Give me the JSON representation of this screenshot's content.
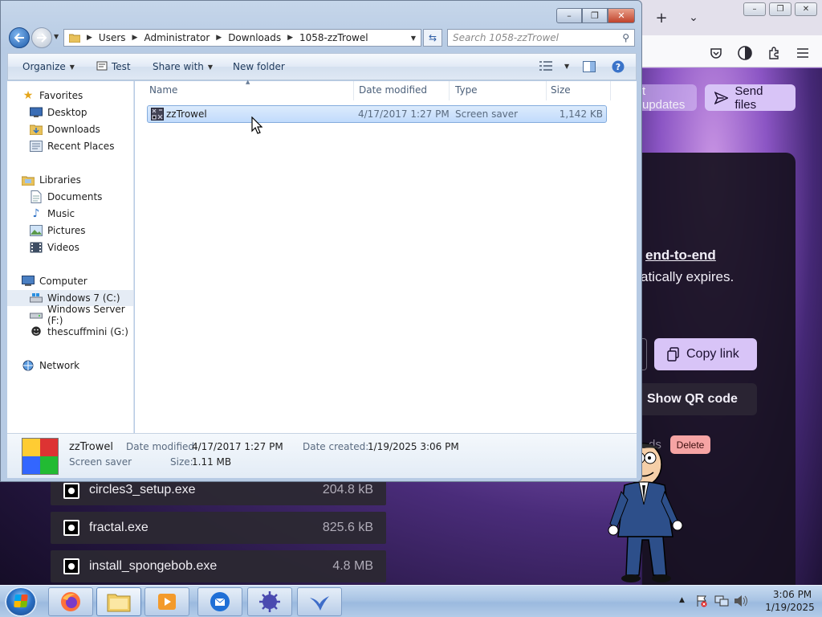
{
  "explorer": {
    "window_controls": {
      "minimize": "–",
      "maximize": "❐",
      "close": "✕"
    },
    "breadcrumb": [
      "Users",
      "Administrator",
      "Downloads",
      "1058-zzTrowel"
    ],
    "search_placeholder": "Search 1058-zzTrowel",
    "command_bar": {
      "organize": "Organize",
      "test": "Test",
      "share_with": "Share with",
      "new_folder": "New folder"
    },
    "nav": {
      "favorites": "Favorites",
      "favorites_items": [
        "Desktop",
        "Downloads",
        "Recent Places"
      ],
      "libraries": "Libraries",
      "libraries_items": [
        "Documents",
        "Music",
        "Pictures",
        "Videos"
      ],
      "computer": "Computer",
      "computer_items": [
        "Windows 7 (C:)",
        "Windows Server (F:)",
        "thescuffmini (G:)"
      ],
      "network": "Network"
    },
    "columns": {
      "name": "Name",
      "date": "Date modified",
      "type": "Type",
      "size": "Size"
    },
    "files": [
      {
        "name": "zzTrowel",
        "date": "4/17/2017 1:27 PM",
        "type": "Screen saver",
        "size": "1,142 KB"
      }
    ],
    "details": {
      "name": "zzTrowel",
      "kind": "Screen saver",
      "date_modified_label": "Date modified:",
      "date_modified": "4/17/2017 1:27 PM",
      "date_created_label": "Date created:",
      "date_created": "1/19/2025 3:06 PM",
      "size_label": "Size:",
      "size": "1.11 MB"
    }
  },
  "browser": {
    "new_tab": "+",
    "tab_list": "⌄",
    "window_controls": {
      "minimize": "–",
      "maximize": "❐",
      "close": "✕"
    },
    "page": {
      "updates_button": "t updates",
      "send_files_button": "Send files",
      "end_to_end": "end-to-end",
      "expires_text": "atically expires.",
      "copy_link": "Copy link",
      "show_qr": "Show QR code",
      "downloads_fragment": "ds",
      "delete": "Delete",
      "files": [
        {
          "name": "circles3_setup.exe",
          "size": "204.8 kB"
        },
        {
          "name": "fractal.exe",
          "size": "825.6 kB"
        },
        {
          "name": "install_spongebob.exe",
          "size": "4.8 MB"
        }
      ]
    }
  },
  "taskbar": {
    "time": "3:06 PM",
    "date": "1/19/2025"
  }
}
